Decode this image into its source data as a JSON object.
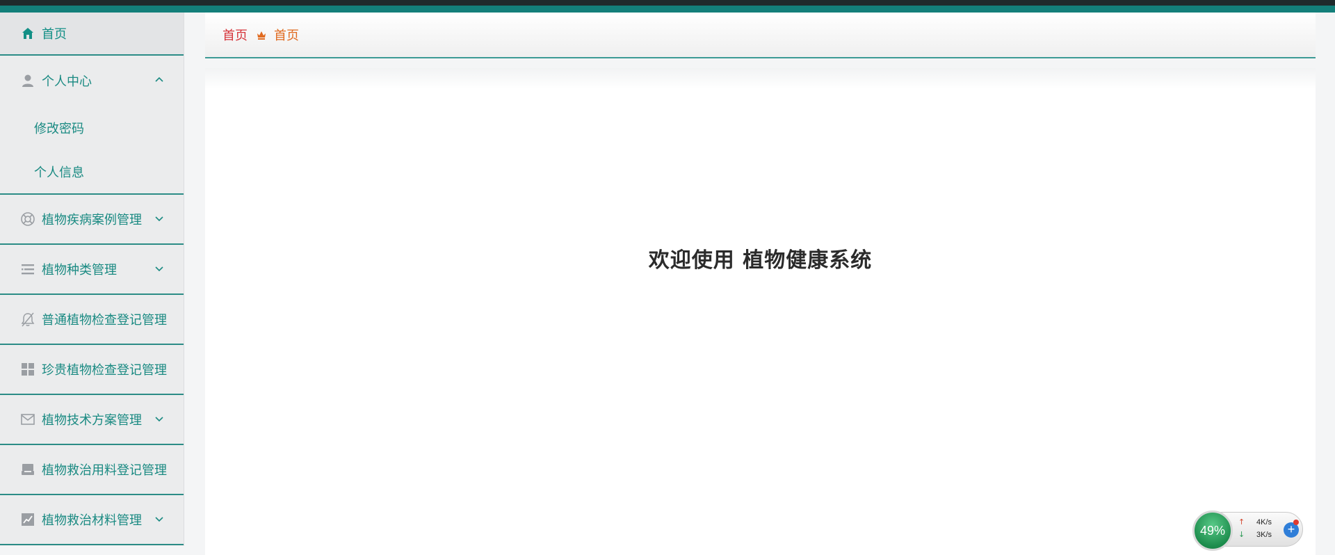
{
  "sidebar": {
    "home": {
      "label": "首页",
      "icon": "home-icon"
    },
    "groups": [
      {
        "label": "个人中心",
        "icon": "user-icon",
        "expanded": true,
        "children": [
          {
            "label": "修改密码"
          },
          {
            "label": "个人信息"
          }
        ]
      },
      {
        "label": "植物疾病案例管理",
        "icon": "lifebuoy-icon",
        "expanded": false
      },
      {
        "label": "植物种类管理",
        "icon": "list-icon",
        "expanded": false
      },
      {
        "label": "普通植物检查登记管理",
        "icon": "bell-off-icon",
        "expanded": false
      },
      {
        "label": "珍贵植物检查登记管理",
        "icon": "grid-icon",
        "expanded": false
      },
      {
        "label": "植物技术方案管理",
        "icon": "mail-icon",
        "expanded": false
      },
      {
        "label": "植物救治用料登记管理",
        "icon": "inbox-icon",
        "expanded": false
      },
      {
        "label": "植物救治材料管理",
        "icon": "chart-icon",
        "expanded": false
      }
    ]
  },
  "breadcrumb": {
    "first": "首页",
    "second": "首页"
  },
  "main": {
    "welcome": "欢迎使用 植物健康系统"
  },
  "net_widget": {
    "percent": "49%",
    "upload": "4K/s",
    "download": "3K/s",
    "plus": "+"
  },
  "colors": {
    "accent": "#1a8a82",
    "topbar": "#137f7a",
    "crumb_red": "#d6343a",
    "crumb_orange": "#e06a1f"
  }
}
